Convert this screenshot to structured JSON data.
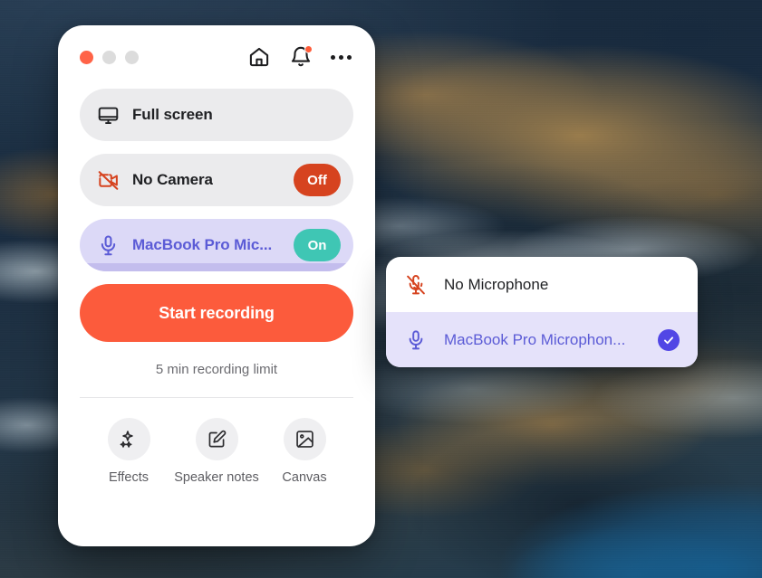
{
  "window": {
    "traffic_lights": [
      {
        "name": "close",
        "color": "#ff6347"
      },
      {
        "name": "minimize",
        "color": "#dcdcdc"
      },
      {
        "name": "maximize",
        "color": "#dcdcdc"
      }
    ],
    "actions": [
      {
        "icon": "home-icon",
        "label": "Home"
      },
      {
        "icon": "bell-icon",
        "label": "Notifications",
        "has_badge": true
      },
      {
        "icon": "more-icon",
        "label": "More options"
      }
    ]
  },
  "rows": {
    "screen": {
      "icon": "monitor-icon",
      "label": "Full screen"
    },
    "camera": {
      "icon": "camera-off-icon",
      "label": "No Camera",
      "badge": "Off",
      "badge_color": "#d6431f"
    },
    "microphone": {
      "icon": "microphone-icon",
      "label": "MacBook Pro Mic...",
      "badge": "On",
      "badge_color": "#3fc6b4"
    }
  },
  "primary": {
    "start_label": "Start recording",
    "start_color": "#fc5b3c",
    "limit_text": "5 min recording limit"
  },
  "toolbar": [
    {
      "icon": "sparkles-icon",
      "label": "Effects"
    },
    {
      "icon": "note-edit-icon",
      "label": "Speaker notes"
    },
    {
      "icon": "image-icon",
      "label": "Canvas"
    }
  ],
  "microphone_dropdown": {
    "items": [
      {
        "icon": "microphone-off-icon",
        "label": "No Microphone",
        "selected": false
      },
      {
        "icon": "microphone-icon",
        "label": "MacBook Pro Microphon...",
        "selected": true
      }
    ],
    "check_color": "#5146e5"
  }
}
